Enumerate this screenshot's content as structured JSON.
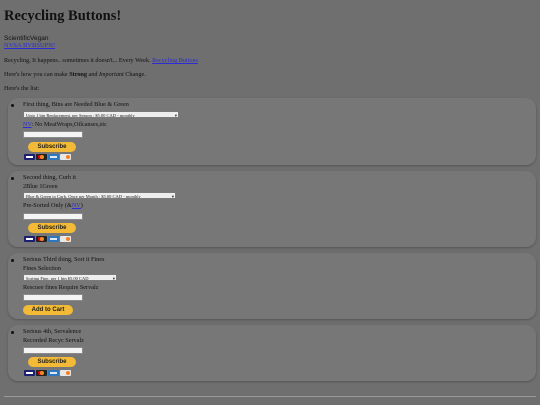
{
  "title": "Recycling Buttons!",
  "author": {
    "name": "ScientificVegan",
    "link": "NVSA BVBSUPN!"
  },
  "intro": {
    "p1_text": "Recycling, It happens.. sometimes it doesn't... Every Week. ",
    "p1_link": "Recycling Buttons",
    "p2_pre": "Here's how you can make ",
    "p2_strong": "Strong",
    "p2_mid": " and ",
    "p2_em": "Important",
    "p2_post": " Change.",
    "p3": "Here's the list:"
  },
  "items": [
    {
      "heading": "First thing, Bins are Needed Blue & Green",
      "select_value": "Upto 1 bin Replacement, per Season : $5.00 CAD - monthly",
      "note_link": "NV",
      "note_text": ": No MeatWraps,Oilcanses,etc",
      "button": "Subscribe"
    },
    {
      "heading": "Second thing, Curb it",
      "sub": "2Blue 1Green",
      "select_value": "Blue & Green to Curb, Once per Month : $5.00 CAD - monthly",
      "note_pre": "Pre-Sorted Only (&",
      "note_link": "NV",
      "note_post": ")",
      "button": "Subscribe"
    },
    {
      "heading": "Serious Third thing, Sort it Fines",
      "sub": "Fines Selection",
      "select_value": "Sorting Fine, per 1 bin $5.00 CAD",
      "note": "Rescuee fines Require Servalz",
      "button": "Add to Cart"
    },
    {
      "heading": "Serious 4th, Servalence",
      "sub": "Recorded Recyc Servalz",
      "button": "Subscribe"
    }
  ],
  "card_icons": [
    "visa-icon",
    "mastercard-icon",
    "amex-icon",
    "discover-icon"
  ]
}
